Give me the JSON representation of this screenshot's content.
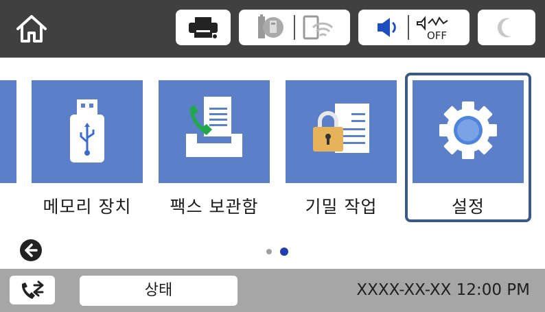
{
  "colors": {
    "topbar": "#404040",
    "tile": "#5b7fc9",
    "selection_border": "#3a5a86",
    "bottombar": "#a6a6a6",
    "page_dot_active": "#1f3fb0",
    "page_dot_inactive": "#a0a0a0"
  },
  "header": {
    "icons": [
      "home-icon",
      "printer-icon",
      "network-status-icon",
      "wifi-icon",
      "speaker-icon",
      "quiet-mode-off-icon",
      "sleep-moon-icon"
    ],
    "quiet_mode_label": "OFF"
  },
  "menu": {
    "tiles": [
      {
        "label": "메모리 장치",
        "icon": "usb-memory-icon"
      },
      {
        "label": "팩스 보관함",
        "icon": "fax-box-icon"
      },
      {
        "label": "기밀 작업",
        "icon": "confidential-job-icon"
      },
      {
        "label": "설정",
        "icon": "gear-icon",
        "selected": true
      }
    ]
  },
  "pagination": {
    "pages": 2,
    "current": 2
  },
  "footer": {
    "fax_icon": "fax-job-icon",
    "status_label": "상태",
    "datetime": "XXXX-XX-XX 12:00 PM"
  }
}
